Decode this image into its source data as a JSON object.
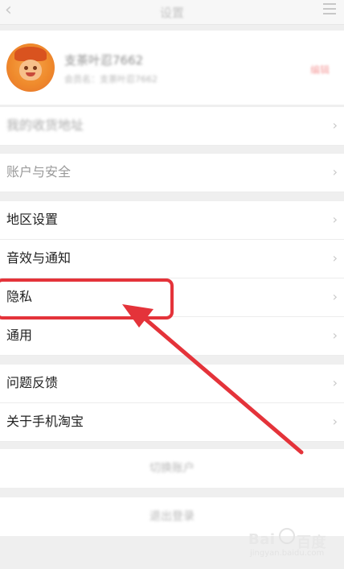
{
  "header": {
    "title": "设置",
    "back_glyph": "‹",
    "menu_icon": "menu-icon"
  },
  "profile": {
    "name": "支茶叶忍7662",
    "sub": "会员名：支茶叶忍7662",
    "tag": "编辑"
  },
  "settings": {
    "address": "我的收货地址",
    "account": "账户与安全",
    "region": "地区设置",
    "sound": "音效与通知",
    "privacy": "隐私",
    "general": "通用",
    "feedback": "问题反馈",
    "about": "关于手机淘宝"
  },
  "chevron": "›",
  "actions": {
    "switch_account": "切换账户",
    "logout": "退出登录"
  },
  "annotation": {
    "color": "#e4333a"
  },
  "watermark": {
    "brand": "Bai",
    "brand2": "百度",
    "site": "jingyan.baidu.com"
  }
}
